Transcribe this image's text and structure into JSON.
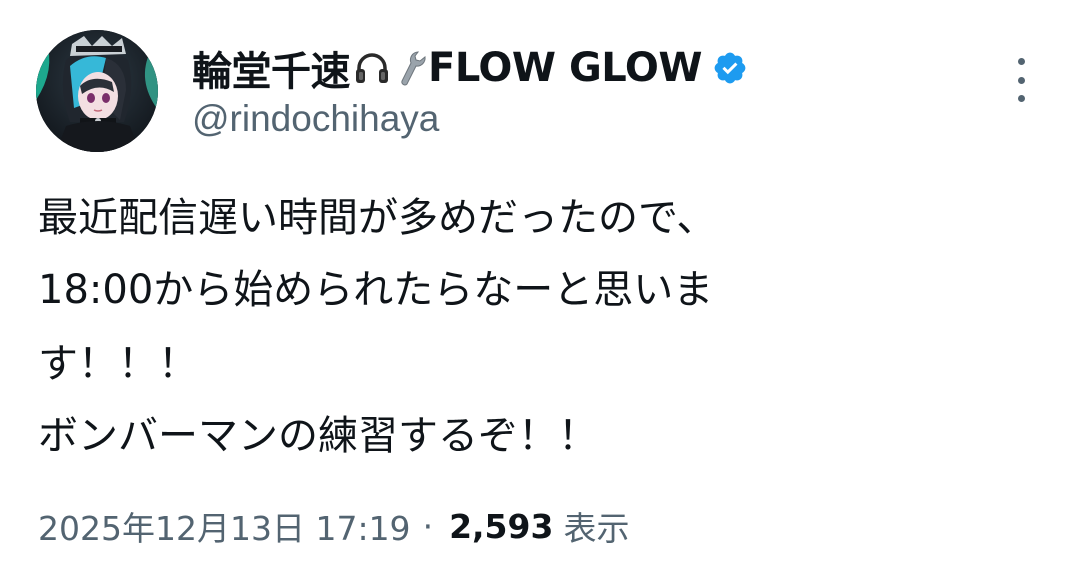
{
  "tweet": {
    "author": {
      "display_name": "輪堂千速",
      "name_suffix": "FLOW GLOW",
      "handle": "@rindochihaya",
      "verified": true,
      "verified_color": "#1d9bf0",
      "emoji": [
        "headphones-icon",
        "wrench-icon"
      ]
    },
    "text_lines": [
      "最近配信遅い時間が多めだったので、",
      "18:00から始められたらなーと思いま",
      "す！！！",
      "ボンバーマンの練習するぞ！！"
    ],
    "timestamp": "2025年12月13日 17:19",
    "separator": "·",
    "views_count": "2,593",
    "views_label": "表示"
  },
  "colors": {
    "text_primary": "#0f1419",
    "text_secondary": "#536471",
    "accent": "#1d9bf0"
  }
}
